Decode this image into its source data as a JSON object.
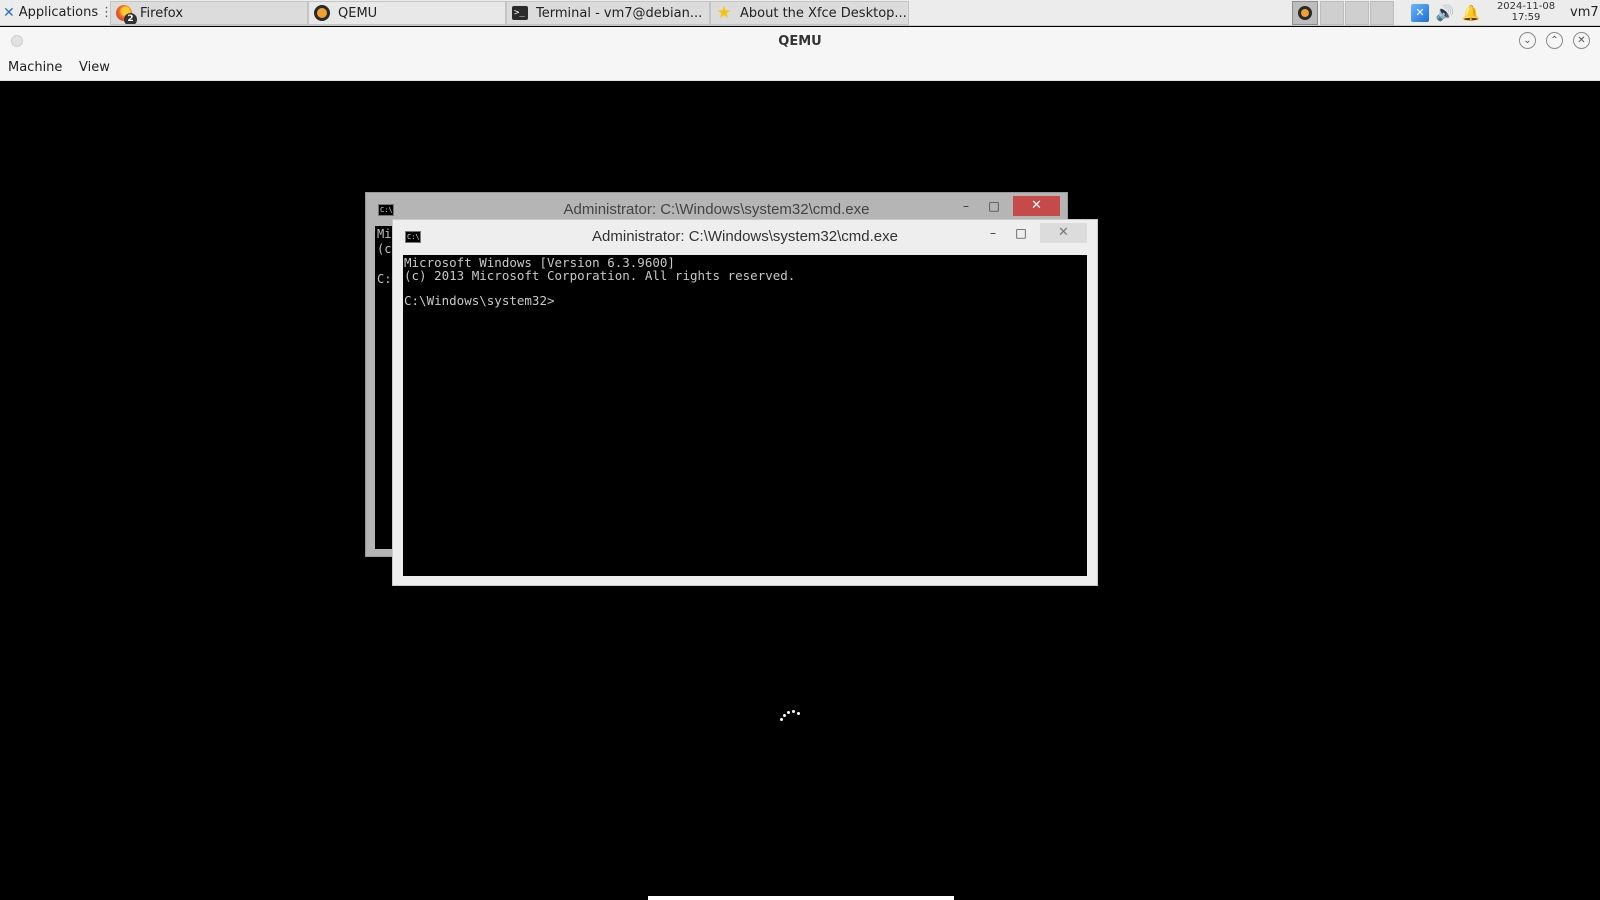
{
  "panel": {
    "applications_label": "Applications",
    "applications_separator": "⋮",
    "tasks": [
      {
        "label": "Firefox",
        "icon": "firefox-icon",
        "badge": "2"
      },
      {
        "label": "QEMU",
        "icon": "qemu-icon"
      },
      {
        "label": "Terminal - vm7@debian...",
        "icon": "terminal-icon"
      },
      {
        "label": "About the Xfce Desktop...",
        "icon": "star-icon"
      }
    ],
    "clock_date": "2024-11-08",
    "clock_time": "17:59",
    "user": "vm7"
  },
  "qemu": {
    "title": "QEMU",
    "menu": [
      "Machine",
      "View"
    ]
  },
  "cmd_back": {
    "title": "Administrator: C:\\Windows\\system32\\cmd.exe",
    "lines": "Mi\n(c\n\nC:"
  },
  "cmd_front": {
    "title": "Administrator: C:\\Windows\\system32\\cmd.exe",
    "lines": "Microsoft Windows [Version 6.3.9600]\n(c) 2013 Microsoft Corporation. All rights reserved.\n\nC:\\Windows\\system32>"
  },
  "colors": {
    "panel_bg": "#ececec",
    "vm_bg": "#000000",
    "close_red": "#c74a4a"
  }
}
